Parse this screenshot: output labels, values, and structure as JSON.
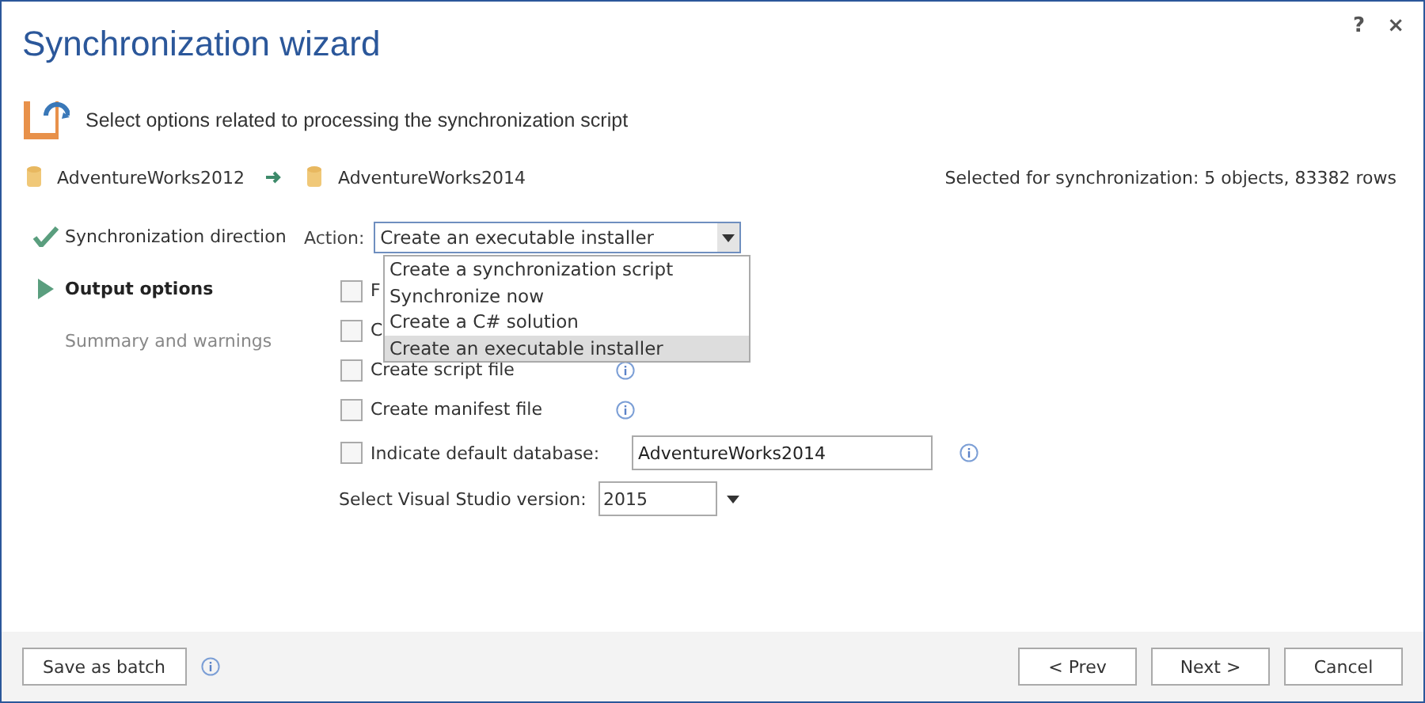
{
  "window": {
    "title": "Synchronization wizard",
    "help": "?",
    "close": "×"
  },
  "subtitle": "Select options related to processing the synchronization script",
  "source": "AdventureWorks2012",
  "target": "AdventureWorks2014",
  "selection_summary": "Selected for synchronization: 5 objects, 83382 rows",
  "steps": [
    {
      "label": "Synchronization direction",
      "kind": "done",
      "selected": false
    },
    {
      "label": "Output options",
      "kind": "current",
      "selected": true
    },
    {
      "label": "Summary and warnings",
      "kind": "pending",
      "selected": false
    }
  ],
  "action": {
    "label": "Action:",
    "value": "Create an executable installer",
    "expanded": true,
    "options": [
      {
        "label": "Create a synchronization script",
        "selected": false
      },
      {
        "label": "Synchronize now",
        "selected": false
      },
      {
        "label": "Create a C# solution",
        "selected": false
      },
      {
        "label": "Create an executable installer",
        "selected": true
      }
    ]
  },
  "options": [
    {
      "label": "F",
      "checked": false,
      "info": false
    },
    {
      "label": "C",
      "checked": false,
      "info": false
    },
    {
      "label": "Create script file",
      "checked": false,
      "info": true
    },
    {
      "label": "Create manifest file",
      "checked": false,
      "info": true
    }
  ],
  "default_database": {
    "label": "Indicate default database:",
    "checked": false,
    "value": "AdventureWorks2014"
  },
  "vs_version": {
    "label": "Select Visual Studio version:",
    "value": "2015"
  },
  "buttons": {
    "save": "Save as batch",
    "prev": "< Prev",
    "next": "Next >",
    "cancel": "Cancel"
  }
}
